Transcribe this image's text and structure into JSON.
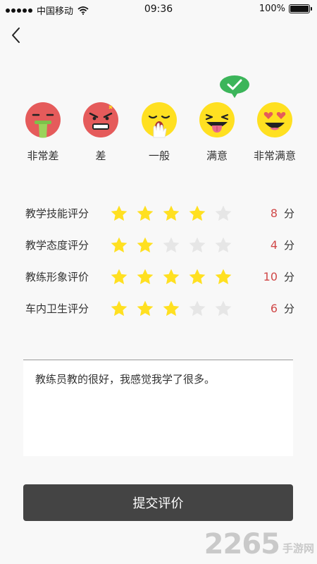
{
  "status_bar": {
    "carrier": "中国移动",
    "time": "09:36",
    "battery": "100%"
  },
  "moods": [
    {
      "label": "非常差",
      "icon": "disgusted-face-icon",
      "color": "#e55b5b"
    },
    {
      "label": "差",
      "icon": "angry-face-icon",
      "color": "#e55b5b"
    },
    {
      "label": "一般",
      "icon": "yawning-face-icon",
      "color": "#ffe021"
    },
    {
      "label": "满意",
      "icon": "tongue-out-face-icon",
      "color": "#ffe021",
      "selected": true
    },
    {
      "label": "非常满意",
      "icon": "heart-eyes-face-icon",
      "color": "#ffe021"
    }
  ],
  "selected_mood": "满意",
  "ratings": [
    {
      "label": "教学技能评分",
      "stars": 4,
      "score": "8",
      "unit": "分"
    },
    {
      "label": "教学态度评分",
      "stars": 2,
      "score": "4",
      "unit": "分"
    },
    {
      "label": "教练形象评价",
      "stars": 5,
      "score": "10",
      "unit": "分"
    },
    {
      "label": "车内卫生评分",
      "stars": 3,
      "score": "6",
      "unit": "分"
    }
  ],
  "max_stars": 5,
  "comment": "教练员教的很好，我感觉我学了很多。",
  "submit_label": "提交评价",
  "watermark": {
    "number": "2265",
    "text": "手游网"
  },
  "colors": {
    "star_on": "#ffe021",
    "star_off": "#e6e6e6",
    "score": "#d04848",
    "check_bubble": "#3cb55a",
    "button": "#444444"
  }
}
